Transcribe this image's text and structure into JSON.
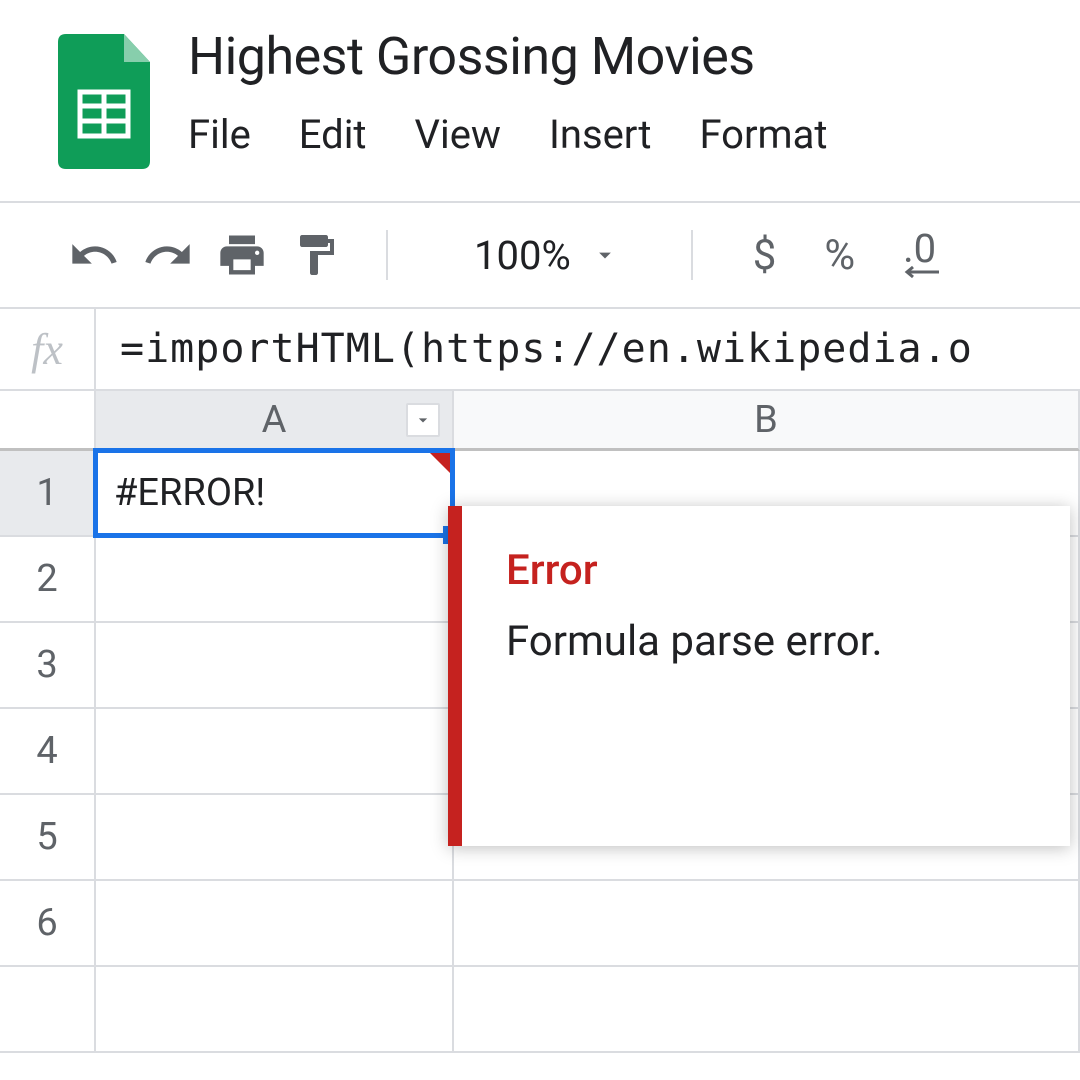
{
  "doc_title": "Highest Grossing Movies",
  "menu": {
    "file": "File",
    "edit": "Edit",
    "view": "View",
    "insert": "Insert",
    "format": "Format"
  },
  "toolbar": {
    "zoom": "100%",
    "currency": "$",
    "percent": "%",
    "decimal": ".0"
  },
  "formula_bar": {
    "fx": "fx",
    "value": "=importHTML(https://en.wikipedia.o"
  },
  "columns": {
    "a": "A",
    "b": "B"
  },
  "rows": [
    "1",
    "2",
    "3",
    "4",
    "5",
    "6"
  ],
  "cells": {
    "a1": "#ERROR!"
  },
  "error_tooltip": {
    "title": "Error",
    "message": "Formula parse error."
  }
}
